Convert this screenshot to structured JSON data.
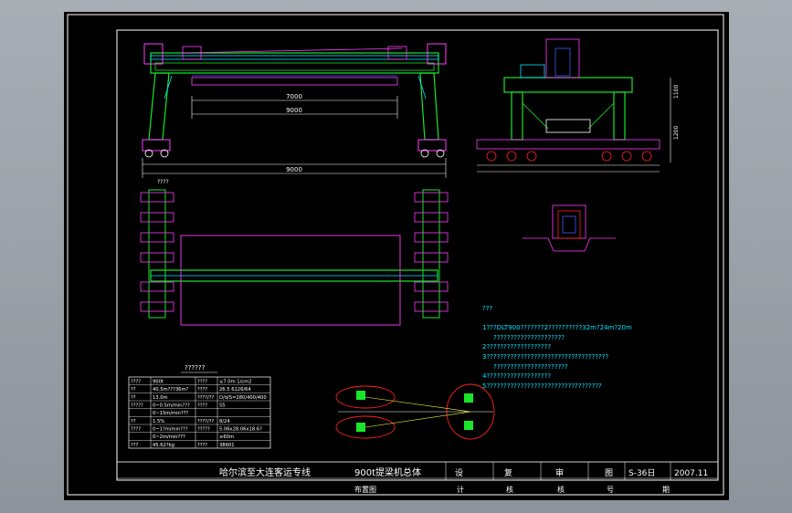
{
  "drawing": {
    "note_heading": "???",
    "notes": [
      "1???DLT900???????2??????????32m?24m?20m",
      "?????????????????????",
      "2???????????????????",
      "3????????????????????????????????????",
      "??????????????????????",
      "4???????????????????",
      "5??????????????????????????????????"
    ],
    "top_label": "????",
    "plan_label": "??????",
    "side_dims": [
      "1100",
      "1200"
    ],
    "front_dims": [
      "7000",
      "9000",
      "9000"
    ],
    "spec_table": [
      [
        "????",
        "900t",
        "????",
        "≤7.0m 1/cm2"
      ],
      [
        "??",
        "40.5m???36m?",
        "????",
        "26.5 6126/64"
      ],
      [
        "??",
        "13.0m",
        "????/??",
        "D/d/S=280/400/400"
      ],
      [
        "?????",
        "0~0.5m/min???",
        "????",
        "55"
      ],
      [
        "",
        "0~15m/min???",
        "",
        ""
      ],
      [
        "??",
        "1.5%",
        "????/??",
        "8/24"
      ],
      [
        "????",
        "0~1?m/min???",
        "?????",
        "5.06x28.06x18.6?"
      ],
      [
        "",
        "0~2m/min???",
        "",
        "≥60m"
      ],
      [
        "???",
        "45.62?kg",
        "????",
        "38601"
      ]
    ],
    "title_block": {
      "project": "哈尔滨至大连客运专线",
      "drawing_title": "900t提梁机总体",
      "drawing_subtitle": "布置图",
      "design": "设",
      "design2": "计",
      "check": "复",
      "check2": "核",
      "review": "审",
      "review2": "核",
      "drawing_no_label": "图",
      "drawing_no_label2": "号",
      "drawing_no": "S-36日",
      "date": "2007.11",
      "date_label": "期"
    }
  },
  "colors": {
    "frame": "#ffffff",
    "green": "#19e62a",
    "cyan": "#00e5ff",
    "magenta": "#ff3cff",
    "yellow": "#ffff3c",
    "red": "#ff2020",
    "blue": "#3b5cff",
    "canvas_bg": "#000000"
  }
}
